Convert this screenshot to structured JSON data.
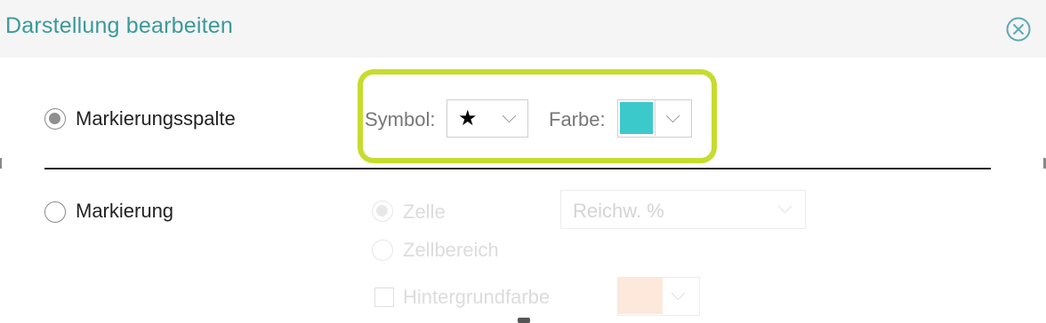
{
  "dialog": {
    "title": "Darstellung bearbeiten",
    "close_icon": "close-circle-icon"
  },
  "option_marker_column": {
    "label": "Markierungsspalte",
    "selected": true,
    "symbol_label": "Symbol:",
    "symbol_value": "★",
    "symbol_icon": "star-icon",
    "color_label": "Farbe:",
    "color_value": "#3cc9cc",
    "highlight_color": "#c6dc2e"
  },
  "option_marker": {
    "label": "Markierung",
    "selected": false,
    "sub_options": {
      "cell": {
        "label": "Zelle",
        "selected": true
      },
      "cell_range": {
        "label": "Zellbereich",
        "selected": false
      }
    },
    "range_select_value": "Reichw. %",
    "background_label": "Hintergrundfarbe",
    "background_checked": false,
    "background_color": "#fde8db"
  }
}
